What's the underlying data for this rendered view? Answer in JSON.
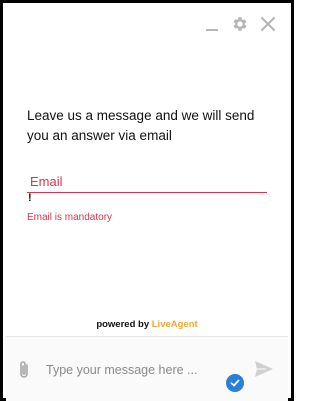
{
  "window": {
    "controls": [
      {
        "name": "minimize-icon"
      },
      {
        "name": "gear-icon"
      },
      {
        "name": "close-icon"
      }
    ]
  },
  "form": {
    "intro": "Leave us a message and we will send you an answer via email",
    "email_placeholder": "Email",
    "email_value": "",
    "required_marker": "!",
    "email_error": "Email is mandatory"
  },
  "footer": {
    "powered_by": "powered by",
    "brand": "LiveAgent"
  },
  "composer": {
    "placeholder": "Type your message here ...",
    "icons": [
      "paperclip-icon",
      "send-icon",
      "check-badge-icon"
    ]
  },
  "colors": {
    "error": "#d8354e",
    "brand": "#f0a830",
    "badge": "#2a80d8",
    "frame": "#000000"
  }
}
